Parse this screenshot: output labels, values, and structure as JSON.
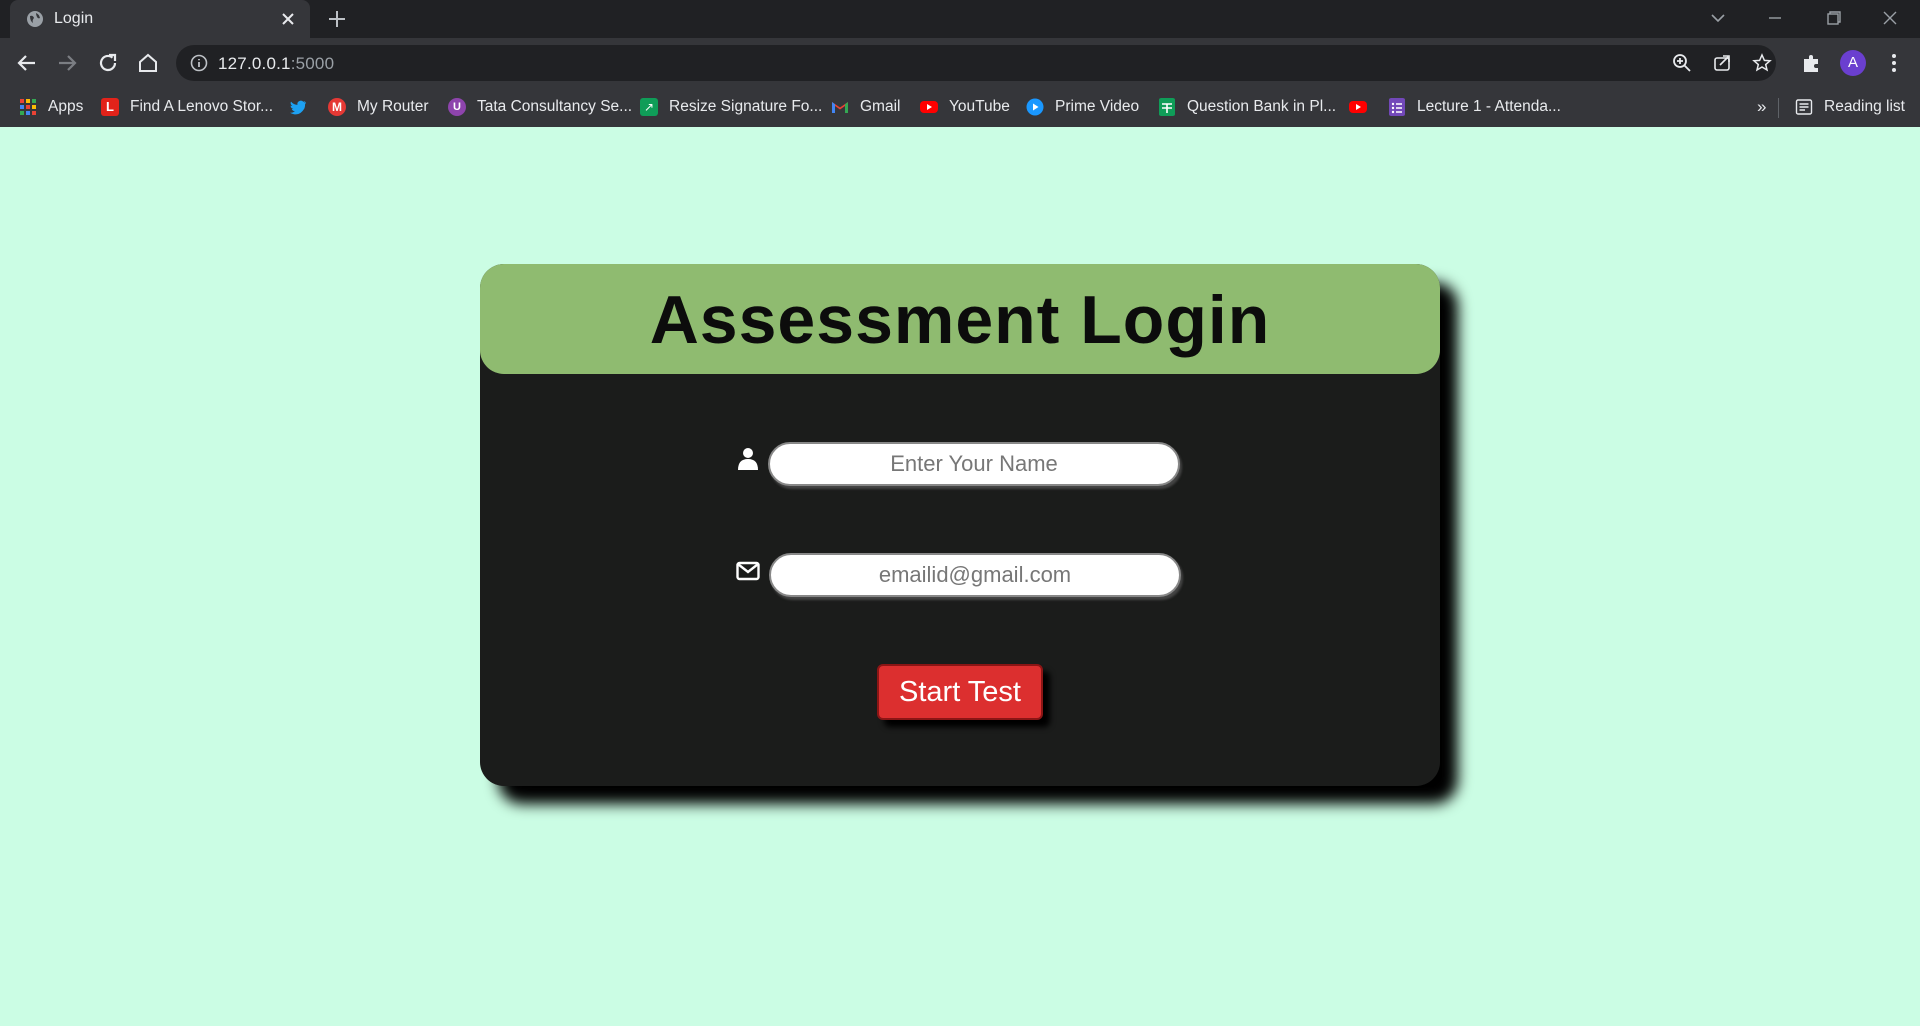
{
  "browser": {
    "tab_title": "Login",
    "url_host": "127.0.0.1",
    "url_port": ":5000",
    "profile_initial": "A",
    "bookmarks": [
      {
        "label": "Apps",
        "icon": "apps-grid-icon",
        "color": "#ea4335"
      },
      {
        "label": "Find A Lenovo Stor...",
        "icon": "lenovo-icon",
        "color": "#e2231a"
      },
      {
        "label": "",
        "icon": "twitter-icon",
        "color": "#1da1f2"
      },
      {
        "label": "My Router",
        "icon": "router-icon",
        "color": "#e53935"
      },
      {
        "label": "Tata Consultancy Se...",
        "icon": "tcs-icon",
        "color": "#8e44ad"
      },
      {
        "label": "Resize Signature Fo...",
        "icon": "resize-icon",
        "color": "#0f9d58"
      },
      {
        "label": "Gmail",
        "icon": "gmail-icon",
        "color": "#ea4335"
      },
      {
        "label": "YouTube",
        "icon": "youtube-icon",
        "color": "#ff0000"
      },
      {
        "label": "Prime Video",
        "icon": "prime-video-icon",
        "color": "#1a98ff"
      },
      {
        "label": "Question Bank in Pl...",
        "icon": "sheets-icon",
        "color": "#0f9d58"
      },
      {
        "label": "",
        "icon": "youtube-icon",
        "color": "#ff0000"
      },
      {
        "label": "Lecture 1 - Attenda...",
        "icon": "forms-icon",
        "color": "#7248b9"
      }
    ],
    "more_bookmarks": "»",
    "reading_list": "Reading list"
  },
  "page": {
    "background": "#cbfde4",
    "title": "Assessment Login",
    "name_placeholder": "Enter Your Name",
    "email_placeholder": "emailid@gmail.com",
    "start_button": "Start Test",
    "header_color": "#8fbb70",
    "button_color": "#dc2f2f"
  }
}
